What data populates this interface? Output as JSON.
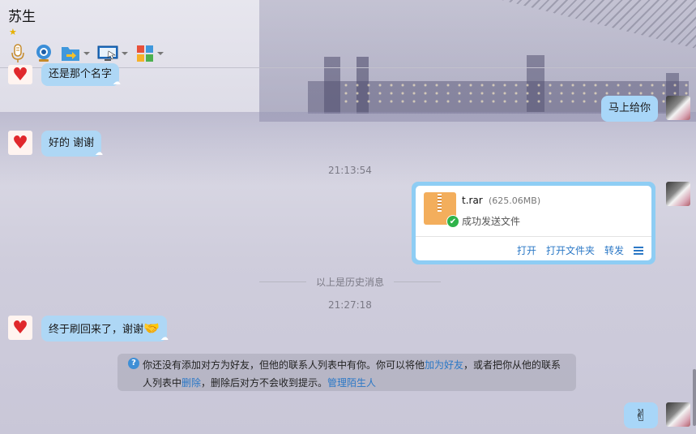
{
  "header": {
    "title": "苏生",
    "star": "★"
  },
  "toolbar": {
    "buttons": [
      {
        "name": "voice",
        "icon": "microphone-icon"
      },
      {
        "name": "video",
        "icon": "webcam-icon"
      },
      {
        "name": "file-transfer",
        "icon": "folder-arrow-icon"
      },
      {
        "name": "remote-desktop",
        "icon": "screen-share-icon"
      },
      {
        "name": "apps",
        "icon": "app-grid-icon"
      }
    ]
  },
  "messages": {
    "m1": {
      "text": "还是那个名字",
      "side": "left"
    },
    "m2": {
      "text": "马上给你",
      "side": "right"
    },
    "m3": {
      "text": "好的 谢谢",
      "side": "left"
    },
    "time1": "21:13:54",
    "file": {
      "name": "t.rar",
      "size": "(625.06MB)",
      "status": "成功发送文件",
      "actions": {
        "open": "打开",
        "open_folder": "打开文件夹",
        "forward": "转发"
      }
    },
    "history_divider": "以上是历史消息",
    "time2": "21:27:18",
    "m4": {
      "text": "终于刷回来了，谢谢",
      "emoji": "🤝",
      "side": "left"
    },
    "m5": {
      "emoji": "✌",
      "side": "right"
    }
  },
  "notice": {
    "part1": "你还没有添加对方为好友，但他的联系人列表中有你。你可以将他",
    "link_add": "加为好友",
    "part2": "，或者把你从他的联系",
    "part3": "人列表中",
    "link_delete": "删除",
    "part4": "，删除后对方不会收到提示。",
    "link_manage": "管理陌生人"
  },
  "colors": {
    "bubble": "#aed7f5",
    "link": "#2b78c6",
    "file_icon": "#f3ae5c"
  }
}
